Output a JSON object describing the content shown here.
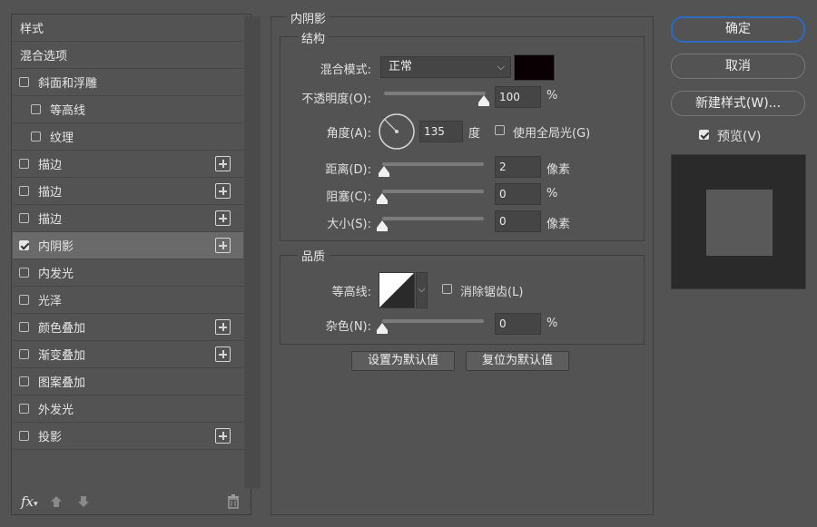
{
  "styles_panel": {
    "header": "样式",
    "blend_options": "混合选项",
    "items": [
      {
        "label": "斜面和浮雕",
        "checked": false,
        "indent": false,
        "has_add": false
      },
      {
        "label": "等高线",
        "checked": false,
        "indent": true,
        "has_add": false
      },
      {
        "label": "纹理",
        "checked": false,
        "indent": true,
        "has_add": false
      },
      {
        "label": "描边",
        "checked": false,
        "indent": false,
        "has_add": true
      },
      {
        "label": "描边",
        "checked": false,
        "indent": false,
        "has_add": true
      },
      {
        "label": "描边",
        "checked": false,
        "indent": false,
        "has_add": true
      },
      {
        "label": "内阴影",
        "checked": true,
        "indent": false,
        "has_add": true,
        "selected": true
      },
      {
        "label": "内发光",
        "checked": false,
        "indent": false,
        "has_add": false
      },
      {
        "label": "光泽",
        "checked": false,
        "indent": false,
        "has_add": false
      },
      {
        "label": "颜色叠加",
        "checked": false,
        "indent": false,
        "has_add": true
      },
      {
        "label": "渐变叠加",
        "checked": false,
        "indent": false,
        "has_add": true
      },
      {
        "label": "图案叠加",
        "checked": false,
        "indent": false,
        "has_add": false
      },
      {
        "label": "外发光",
        "checked": false,
        "indent": false,
        "has_add": false
      },
      {
        "label": "投影",
        "checked": false,
        "indent": false,
        "has_add": true
      }
    ],
    "fx_label": "fx"
  },
  "inner_shadow": {
    "title": "内阴影",
    "structure": {
      "title": "结构",
      "blend_mode_label": "混合模式:",
      "blend_mode_value": "正常",
      "shadow_color": "#0a0004",
      "opacity_label": "不透明度(O):",
      "opacity_value": "100",
      "opacity_fraction": 1.0,
      "percent": "%",
      "angle_label": "角度(A):",
      "angle_value": "135",
      "angle_unit": "度",
      "global_light_label": "使用全局光(G)",
      "global_light_checked": false,
      "distance_label": "距离(D):",
      "distance_value": "2",
      "distance_unit": "像素",
      "distance_fraction": 0.02,
      "choke_label": "阻塞(C):",
      "choke_value": "0",
      "choke_unit": "%",
      "choke_fraction": 0.0,
      "size_label": "大小(S):",
      "size_value": "0",
      "size_unit": "像素",
      "size_fraction": 0.0
    },
    "quality": {
      "title": "品质",
      "contour_label": "等高线:",
      "anti_alias_label": "消除锯齿(L)",
      "anti_alias_checked": false,
      "noise_label": "杂色(N):",
      "noise_value": "0",
      "noise_unit": "%",
      "noise_fraction": 0.0
    },
    "make_default": "设置为默认值",
    "reset_default": "复位为默认值"
  },
  "buttons": {
    "ok": "确定",
    "cancel": "取消",
    "new_style": "新建样式(W)...",
    "preview_label": "预览(V)",
    "preview_checked": true
  },
  "colors": {
    "accent": "#2d6ac4",
    "selected_row": "#6a6a6a"
  }
}
